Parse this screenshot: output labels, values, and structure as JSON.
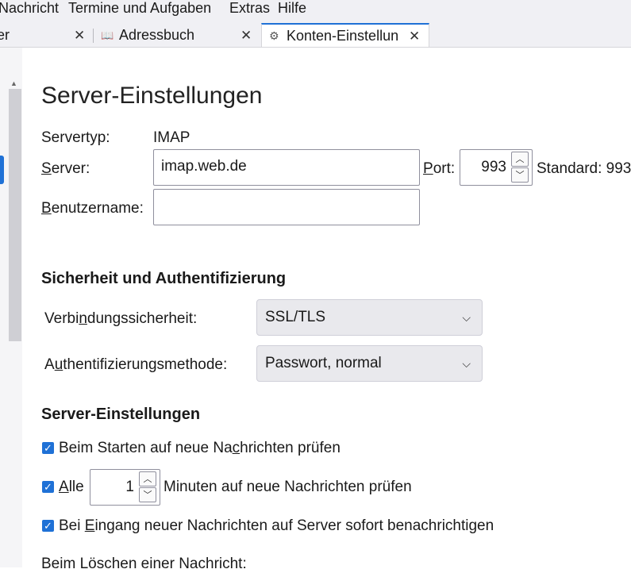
{
  "menubar": {
    "items": [
      "Nachricht",
      "Termine und Aufgaben",
      "Extras",
      "Hilfe"
    ]
  },
  "tabs": [
    {
      "label": "er",
      "close": "✕"
    },
    {
      "label": "Adressbuch",
      "close": "✕"
    },
    {
      "label": "Konten-Einstellun",
      "close": "✕"
    }
  ],
  "page": {
    "title": "Server-Einstellungen",
    "servertype_label": "Servertyp:",
    "servertype_value": "IMAP",
    "server_label": "Server:",
    "server_value": "imap.web.de",
    "port_label": "Port:",
    "port_value": "993",
    "port_default": "Standard: 993",
    "username_label": "Benutzername:",
    "username_value": ""
  },
  "security": {
    "heading": "Sicherheit und Authentifizierung",
    "connection_label": "Verbindungssicherheit:",
    "connection_value": "SSL/TLS",
    "auth_label": "Authentifizierungsmethode:",
    "auth_value": "Passwort, normal"
  },
  "server_settings": {
    "heading": "Server-Einstellungen",
    "check_on_start": "Beim Starten auf neue Nachrichten prüfen",
    "check_every_label": "Alle",
    "check_every_value": "1",
    "check_every_suffix": "Minuten auf neue Nachrichten prüfen",
    "notify_immediately": "Bei Eingang neuer Nachrichten auf Server sofort benachrichtigen",
    "on_delete_label": "Beim Löschen einer Nachricht:"
  },
  "colors": {
    "accent": "#1f71d6"
  }
}
